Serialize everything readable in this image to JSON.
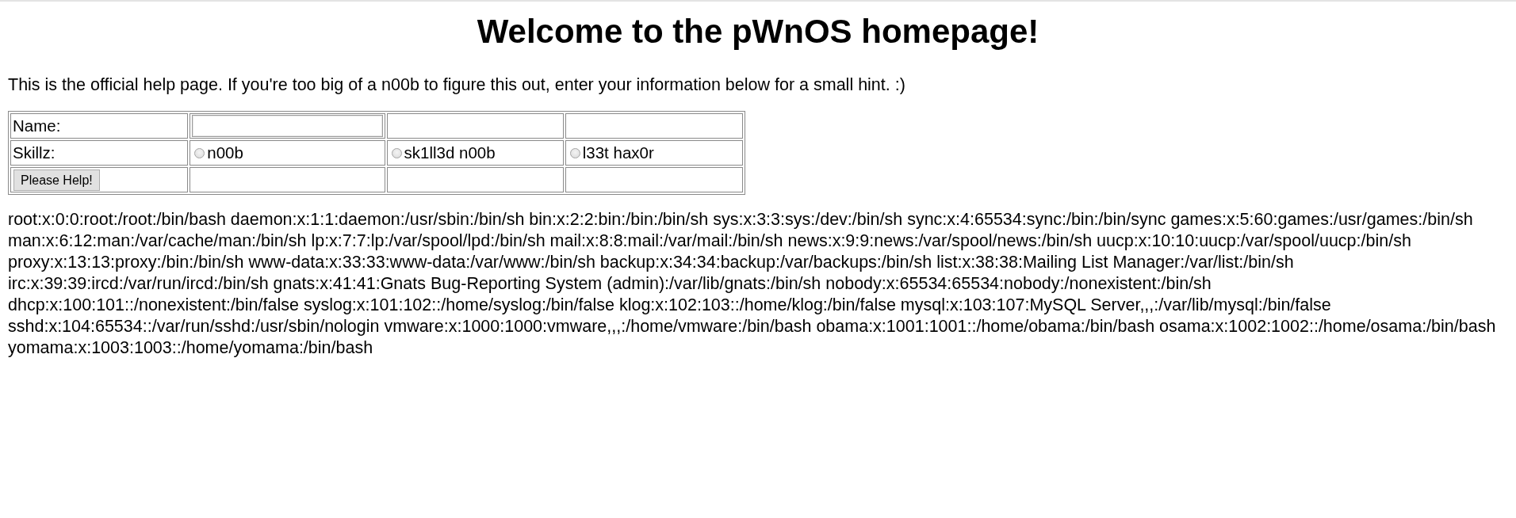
{
  "heading": "Welcome to the pWnOS homepage!",
  "intro": "This is the official help page. If you're too big of a n00b to figure this out, enter your information below for a small hint. :)",
  "form": {
    "name_label": "Name:",
    "skill_label": "Skillz:",
    "skill_options": [
      {
        "label": "n00b",
        "selected": false
      },
      {
        "label": "sk1ll3d n00b",
        "selected": false
      },
      {
        "label": "l33t hax0r",
        "selected": false
      }
    ],
    "submit_button": "Please Help!"
  },
  "output": {
    "lines": [
      "root:x:0:0:root:/root:/bin/bash daemon:x:1:1:daemon:/usr/sbin:/bin/sh bin:x:2:2:bin:/bin:/bin/sh sys:x:3:3:sys:/dev:/bin/sh sync:x:4:65534:sync:/bin:/bin/sync games:x:5:60:games:/usr/games:/bin/sh",
      "man:x:6:12:man:/var/cache/man:/bin/sh lp:x:7:7:lp:/var/spool/lpd:/bin/sh mail:x:8:8:mail:/var/mail:/bin/sh news:x:9:9:news:/var/spool/news:/bin/sh uucp:x:10:10:uucp:/var/spool/uucp:/bin/sh",
      "proxy:x:13:13:proxy:/bin:/bin/sh www-data:x:33:33:www-data:/var/www:/bin/sh backup:x:34:34:backup:/var/backups:/bin/sh list:x:38:38:Mailing List Manager:/var/list:/bin/sh",
      "irc:x:39:39:ircd:/var/run/ircd:/bin/sh gnats:x:41:41:Gnats Bug-Reporting System (admin):/var/lib/gnats:/bin/sh nobody:x:65534:65534:nobody:/nonexistent:/bin/sh",
      "dhcp:x:100:101::/nonexistent:/bin/false syslog:x:101:102::/home/syslog:/bin/false klog:x:102:103::/home/klog:/bin/false mysql:x:103:107:MySQL Server,,,:/var/lib/mysql:/bin/false",
      "sshd:x:104:65534::/var/run/sshd:/usr/sbin/nologin vmware:x:1000:1000:vmware,,,:/home/vmware:/bin/bash obama:x:1001:1001::/home/obama:/bin/bash osama:x:1002:1002::/home/osama:/bin/bash",
      "yomama:x:1003:1003::/home/yomama:/bin/bash"
    ]
  }
}
